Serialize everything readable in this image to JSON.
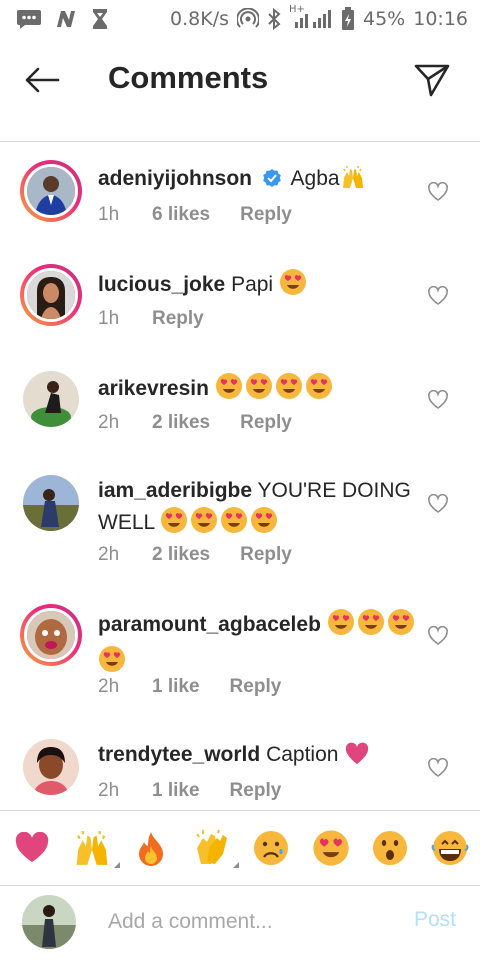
{
  "status_bar": {
    "speed": "0.8K/s",
    "network": "H+",
    "battery": "45%",
    "time": "10:16",
    "icons": [
      "chat-bubble-icon",
      "news-n-icon",
      "hourglass-icon",
      "hotspot-icon",
      "bluetooth-icon",
      "signal-icon",
      "battery-icon"
    ]
  },
  "header": {
    "title": "Comments",
    "back_icon": "arrow-left-icon",
    "send_icon": "paper-plane-icon"
  },
  "colors": {
    "verified": "#3897f0",
    "post_disabled": "#b2dffc",
    "muted": "#8e8e8e",
    "heart_emoji": "#e0457b"
  },
  "comments": [
    {
      "username": "adeniyijohnson",
      "verified": true,
      "text": "Agba",
      "emojis": [
        "raised-hands-icon"
      ],
      "time": "1h",
      "likes": "6 likes",
      "reply": "Reply",
      "story_ring": true
    },
    {
      "username": "lucious_joke",
      "verified": false,
      "text": "Papi",
      "emojis": [
        "heart-eyes-icon"
      ],
      "time": "1h",
      "likes": "",
      "reply": "Reply",
      "story_ring": true
    },
    {
      "username": "arikevresin",
      "verified": false,
      "text": "",
      "emojis": [
        "heart-eyes-icon",
        "heart-eyes-icon",
        "heart-eyes-icon",
        "heart-eyes-icon"
      ],
      "time": "2h",
      "likes": "2 likes",
      "reply": "Reply",
      "story_ring": false
    },
    {
      "username": "iam_aderibigbe",
      "verified": false,
      "text": "YOU'RE DOING WELL",
      "emojis": [
        "heart-eyes-icon",
        "heart-eyes-icon",
        "heart-eyes-icon",
        "heart-eyes-icon"
      ],
      "time": "2h",
      "likes": "2 likes",
      "reply": "Reply",
      "story_ring": false
    },
    {
      "username": "paramount_agbaceleb",
      "verified": false,
      "text": "",
      "emojis": [
        "heart-eyes-icon",
        "heart-eyes-icon",
        "heart-eyes-icon",
        "heart-eyes-icon"
      ],
      "time": "2h",
      "likes": "1 like",
      "reply": "Reply",
      "story_ring": true
    },
    {
      "username": "trendytee_world",
      "verified": false,
      "text": "Caption",
      "emojis": [
        "pink-heart-icon"
      ],
      "time": "2h",
      "likes": "1 like",
      "reply": "Reply",
      "story_ring": false
    }
  ],
  "emoji_bar": [
    "red-heart-icon",
    "raised-hands-icon",
    "fire-icon",
    "clapping-hands-icon",
    "sad-face-icon",
    "heart-eyes-icon",
    "surprised-face-icon",
    "grinning-face-icon"
  ],
  "add_comment": {
    "placeholder": "Add a comment...",
    "post_label": "Post"
  }
}
